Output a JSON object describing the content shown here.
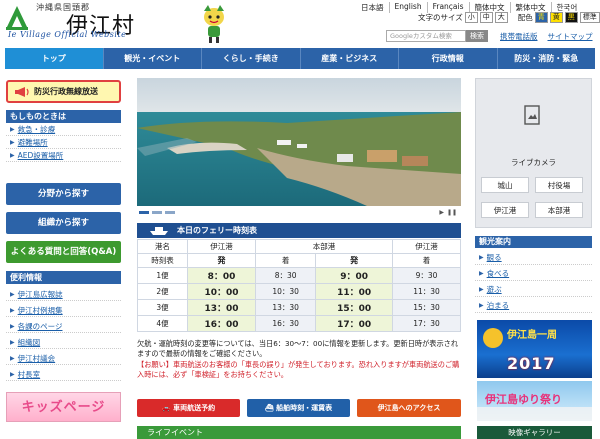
{
  "header": {
    "logo_sub": "沖縄県国頭郡",
    "logo_title": "伊江村",
    "logo_en": "Ie Village Official Website",
    "languages": [
      "日本語",
      "English",
      "Français",
      "簡体中文",
      "繁体中文",
      "한국어"
    ],
    "font_size_label": "文字のサイズ",
    "font_sizes": [
      "小",
      "中",
      "大"
    ],
    "color_label": "配色",
    "color_options": [
      "青",
      "黄",
      "黒",
      "標準"
    ],
    "search_placeholder": "Googleカスタム検索",
    "search_button": "検索",
    "links": [
      "携帯電話版",
      "サイトマップ"
    ]
  },
  "nav": {
    "items": [
      "トップ",
      "観光・イベント",
      "くらし・手続き",
      "産業・ビジネス",
      "行政情報",
      "防災・消防・緊急"
    ],
    "active": 0
  },
  "left": {
    "radio_label": "防災行政無線放送",
    "emergency_title": "もしものときは",
    "emergency_items": [
      "救急・診療",
      "避難場所",
      "AED設置場所"
    ],
    "search_by_field": "分野から探す",
    "search_by_org": "組織から探す",
    "faq": "よくある質問と回答(Q&A)",
    "convenience_title": "便利情報",
    "convenience_items": [
      "伊江島広報誌",
      "伊江村例規集",
      "各課のページ",
      "組織図",
      "伊江村議会",
      "村長室"
    ],
    "kids_banner": "キッズページ"
  },
  "ferry": {
    "title": "本日のフェリー時刻表",
    "port_header": [
      "港名",
      "伊江港",
      "本部港",
      "伊江港"
    ],
    "dir_header": [
      "時刻表",
      "発",
      "着",
      "発",
      "着"
    ],
    "rows": [
      [
        "1便",
        "8：00",
        "8：30",
        "9：00",
        "9：30"
      ],
      [
        "2便",
        "10：00",
        "10：30",
        "11：00",
        "11：30"
      ],
      [
        "3便",
        "13：00",
        "13：30",
        "15：00",
        "15：30"
      ],
      [
        "4便",
        "16：00",
        "16：30",
        "17：00",
        "17：30"
      ]
    ],
    "notice": "欠航・運航時刻の変更等については、当日6：30〜7：00に情報を更新します。更新日時が表示されますので最新の情報をご確認ください。",
    "warning": "【お願い】車両航送のお客様の「車長の誤り」が発生しております。恐れ入りますが車両航送のご購入時には、必ず「車検証」をお持ちください。"
  },
  "actions": [
    "車両航送予約",
    "船舶時刻・運賃表",
    "伊江島へのアクセス"
  ],
  "life_event": "ライフイベント",
  "right": {
    "camera_label": "ライブカメラ",
    "camera_buttons": [
      "城山",
      "村役場",
      "伊江港",
      "本部港"
    ],
    "tour_title": "観光案内",
    "tour_items": [
      "観る",
      "食べる",
      "遊ぶ",
      "泊まる"
    ],
    "banner1_text": "伊江島一周",
    "banner1_year": "2017",
    "banner2_text": "伊江島ゆり祭り",
    "banner3_text": "映像ギャラリー"
  },
  "colors": {
    "nav_blue": "#2c63a8",
    "nav_active": "#1f8fd6",
    "ferry_head": "#1f4f91",
    "action_red": "#d92a2a",
    "action_blue": "#2160a8",
    "action_orange": "#e0561b",
    "life_green": "#3a9a3a",
    "faq_green": "#3d9a2f"
  }
}
